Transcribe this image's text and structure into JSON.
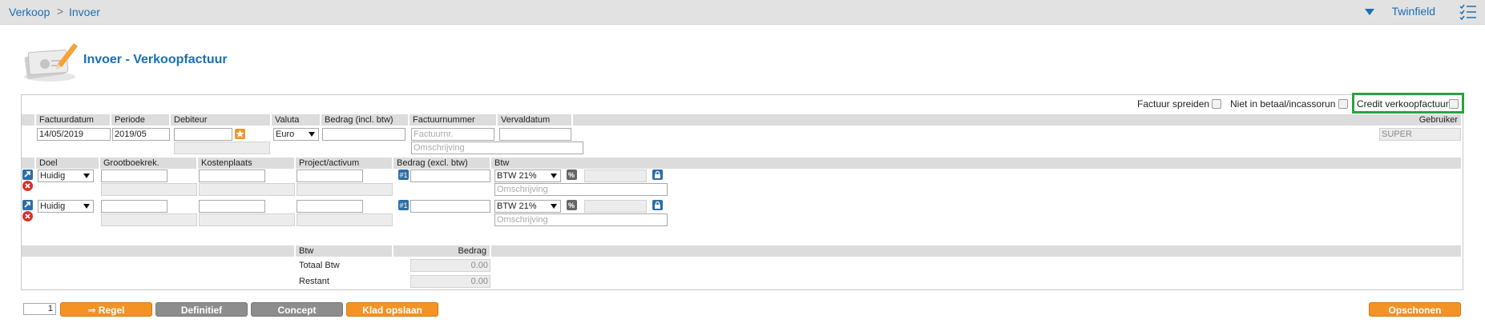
{
  "breadcrumb": {
    "home": "Verkoop",
    "separator": ">",
    "current": "Invoer"
  },
  "header": {
    "organization": "Twinfield"
  },
  "page": {
    "title": "Invoer - Verkoopfactuur"
  },
  "options": {
    "spread_invoice": "Factuur spreiden",
    "not_in_payment_run": "Niet in betaal/incassorun",
    "credit_invoice": "Credit verkoopfactuur"
  },
  "invoice_header": {
    "columns": [
      "Factuurdatum",
      "Periode",
      "Debiteur",
      "Valuta",
      "Bedrag (incl. btw)",
      "Factuurnummer",
      "Vervaldatum",
      "Gebruiker"
    ],
    "values": {
      "date": "14/05/2019",
      "period": "2019/05",
      "debtor": "",
      "currency": "Euro",
      "amount": "",
      "invoice_number_placeholder": "Factuurnr.",
      "due_date": "",
      "user": "SUPER",
      "description_placeholder": "Omschrijving"
    }
  },
  "lines": {
    "columns": [
      "Doel",
      "Grootboekrek.",
      "Kostenplaats",
      "Project/activum",
      "Bedrag (excl. btw)",
      "Btw"
    ],
    "rows": [
      {
        "doel": "Huidig",
        "vat": "BTW 21%",
        "description_placeholder": "Omschrijving"
      },
      {
        "doel": "Huidig",
        "vat": "BTW 21%",
        "description_placeholder": "Omschrijving"
      }
    ]
  },
  "totals": {
    "columns": [
      "Btw",
      "Bedrag"
    ],
    "vat_total_label": "Totaal Btw",
    "vat_total_value": "0.00",
    "remaining_label": "Restant",
    "remaining_value": "0.00"
  },
  "footer": {
    "page_number": "1",
    "buttons": {
      "line": "⇒ Regel",
      "final": "Definitief",
      "concept": "Concept",
      "draft_save": "Klad opslaan",
      "clean": "Opschonen"
    }
  },
  "colors": {
    "accent": "#1a6fb5",
    "orange": "#f39323",
    "highlight": "#2ea043"
  }
}
